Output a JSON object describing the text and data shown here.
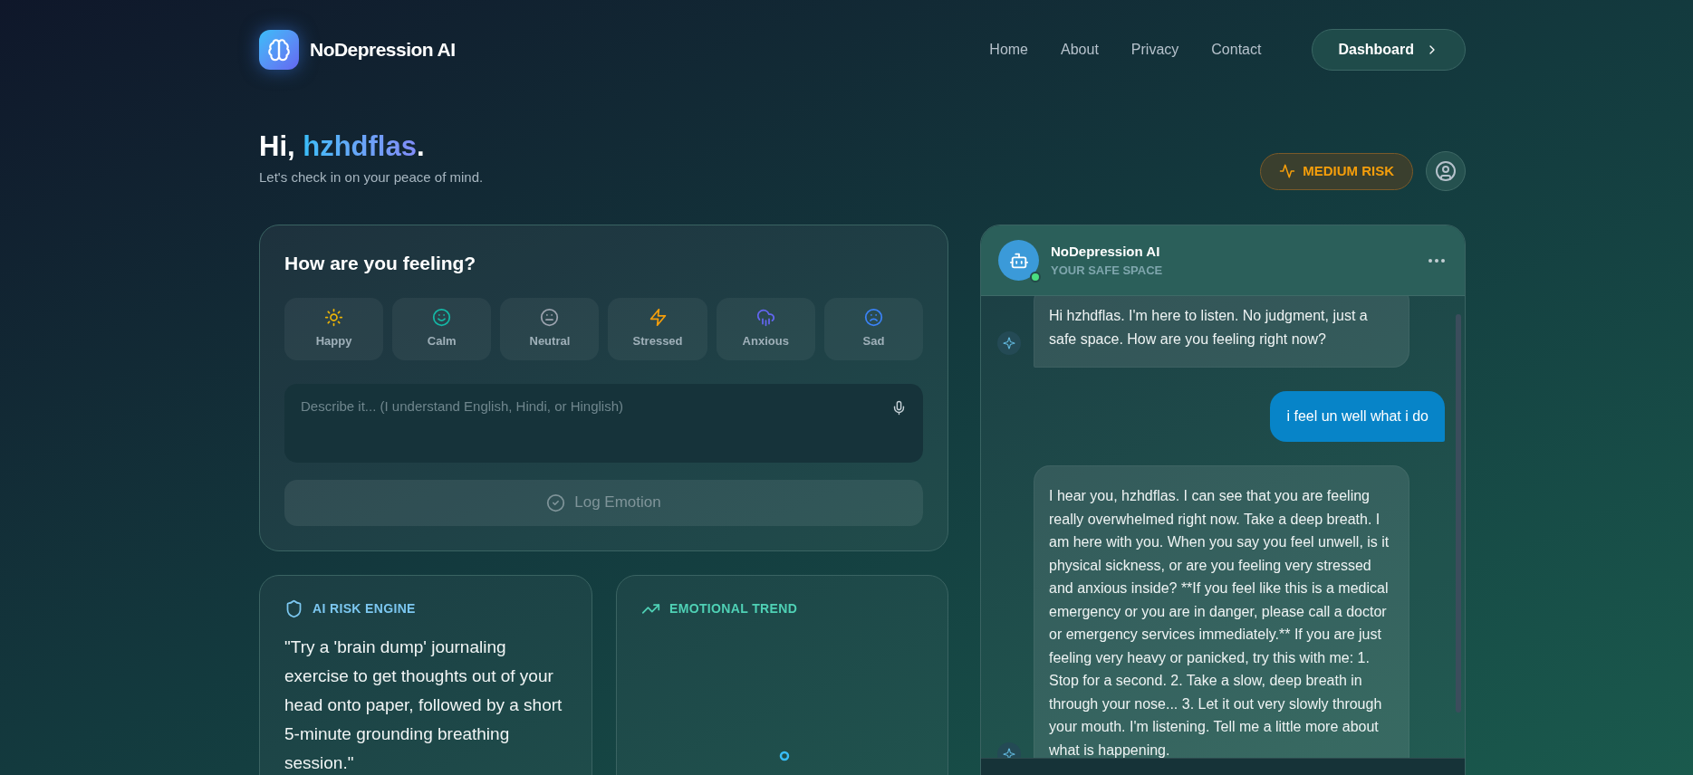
{
  "nav": {
    "brand": "NoDepression AI",
    "links": [
      "Home",
      "About",
      "Privacy",
      "Contact"
    ],
    "dashboard_button": "Dashboard"
  },
  "greeting": {
    "hello": "Hi,",
    "name": "hzhdflas",
    "punctuation": ".",
    "subtitle": "Let's check in on your peace of mind."
  },
  "risk_badge": {
    "label": "MEDIUM RISK"
  },
  "mood_card": {
    "title": "How are you feeling?",
    "moods": [
      {
        "label": "Happy",
        "kind": "sun",
        "color": "#eab308"
      },
      {
        "label": "Calm",
        "kind": "smile",
        "color": "#14b8a6"
      },
      {
        "label": "Neutral",
        "kind": "meh",
        "color": "#9ca3af"
      },
      {
        "label": "Stressed",
        "kind": "bolt",
        "color": "#f59e0b"
      },
      {
        "label": "Anxious",
        "kind": "rain",
        "color": "#6366f1"
      },
      {
        "label": "Sad",
        "kind": "frown",
        "color": "#3b82f6"
      }
    ],
    "description": {
      "placeholder": "Describe it... (I understand English, Hindi, or Hinglish)"
    },
    "log_button": {
      "label": "Log Emotion",
      "disabled": true
    }
  },
  "risk_engine": {
    "title": "AI RISK ENGINE",
    "suggestion": "\"Try a 'brain dump' journaling exercise to get thoughts out of your head onto paper, followed by a short 5-minute grounding breathing session.\""
  },
  "trend": {
    "title": "EMOTIONAL TREND"
  },
  "chat": {
    "title": "NoDepression AI",
    "subtitle": "YOUR SAFE SPACE",
    "messages": [
      {
        "kind": "ai",
        "text": "Hi hzhdflas. I'm here to listen. No judgment, just a safe space. How are you feeling right now?"
      },
      {
        "kind": "user",
        "text": "i feel un well what i do"
      },
      {
        "kind": "ai",
        "text": "I hear you, hzhdflas. I can see that you are feeling really overwhelmed right now. Take a deep breath. I am here with you. When you say you feel unwell, is it physical sickness, or are you feeling very stressed and anxious inside? **If you feel like this is a medical emergency or you are in danger, please call a doctor or emergency services immediately.** If you are just feeling very heavy or panicked, try this with me: 1. Stop for a second. 2. Take a slow, deep breath in through your nose... 3. Let it out very slowly through your mouth. I'm listening. Tell me a little more about what is happening."
      }
    ]
  }
}
